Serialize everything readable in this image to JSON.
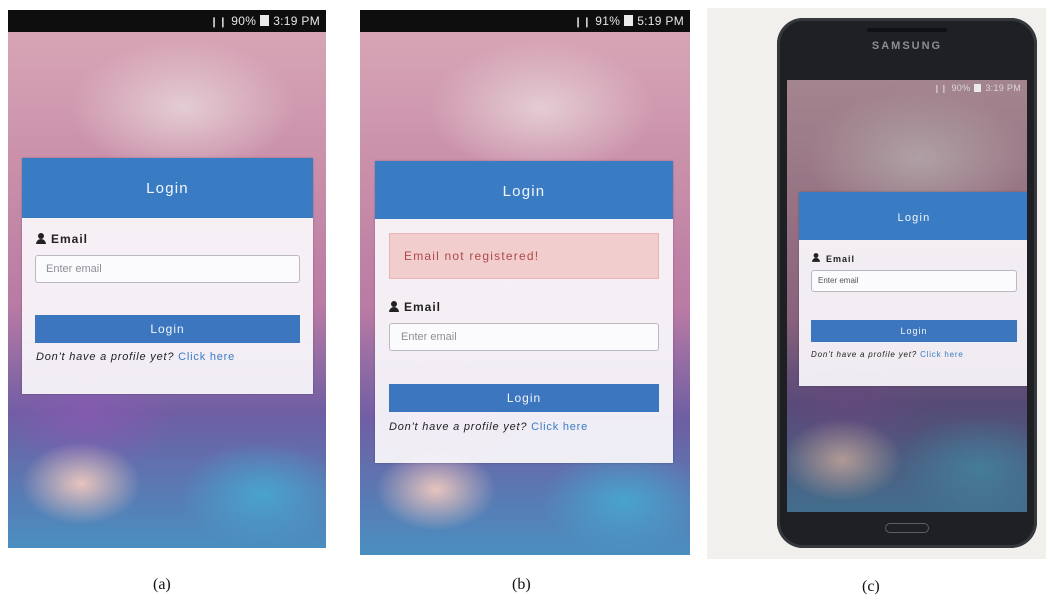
{
  "status_bar": {
    "a": "3:19 PM",
    "b": "5:19 PM",
    "c": "3:19 PM",
    "a_pct": "90%",
    "b_pct": "91%",
    "c_pct": "90%"
  },
  "login": {
    "title": "Login",
    "email_label": "Email",
    "email_placeholder": "Enter email",
    "button_label": "Login",
    "footer_text": "Don't have a profile yet?",
    "footer_link": "Click here",
    "error_message": "Email not registered!"
  },
  "phone": {
    "brand": "SAMSUNG"
  },
  "captions": {
    "a": "(a)",
    "b": "(b)",
    "c": "(c)"
  },
  "colors": {
    "header": "#3a7cc4",
    "button": "#3b76be",
    "alert_bg": "#f1cdcd",
    "alert_text": "#b04848"
  },
  "icons": [
    "user-icon",
    "signal-icon",
    "battery-icon"
  ]
}
